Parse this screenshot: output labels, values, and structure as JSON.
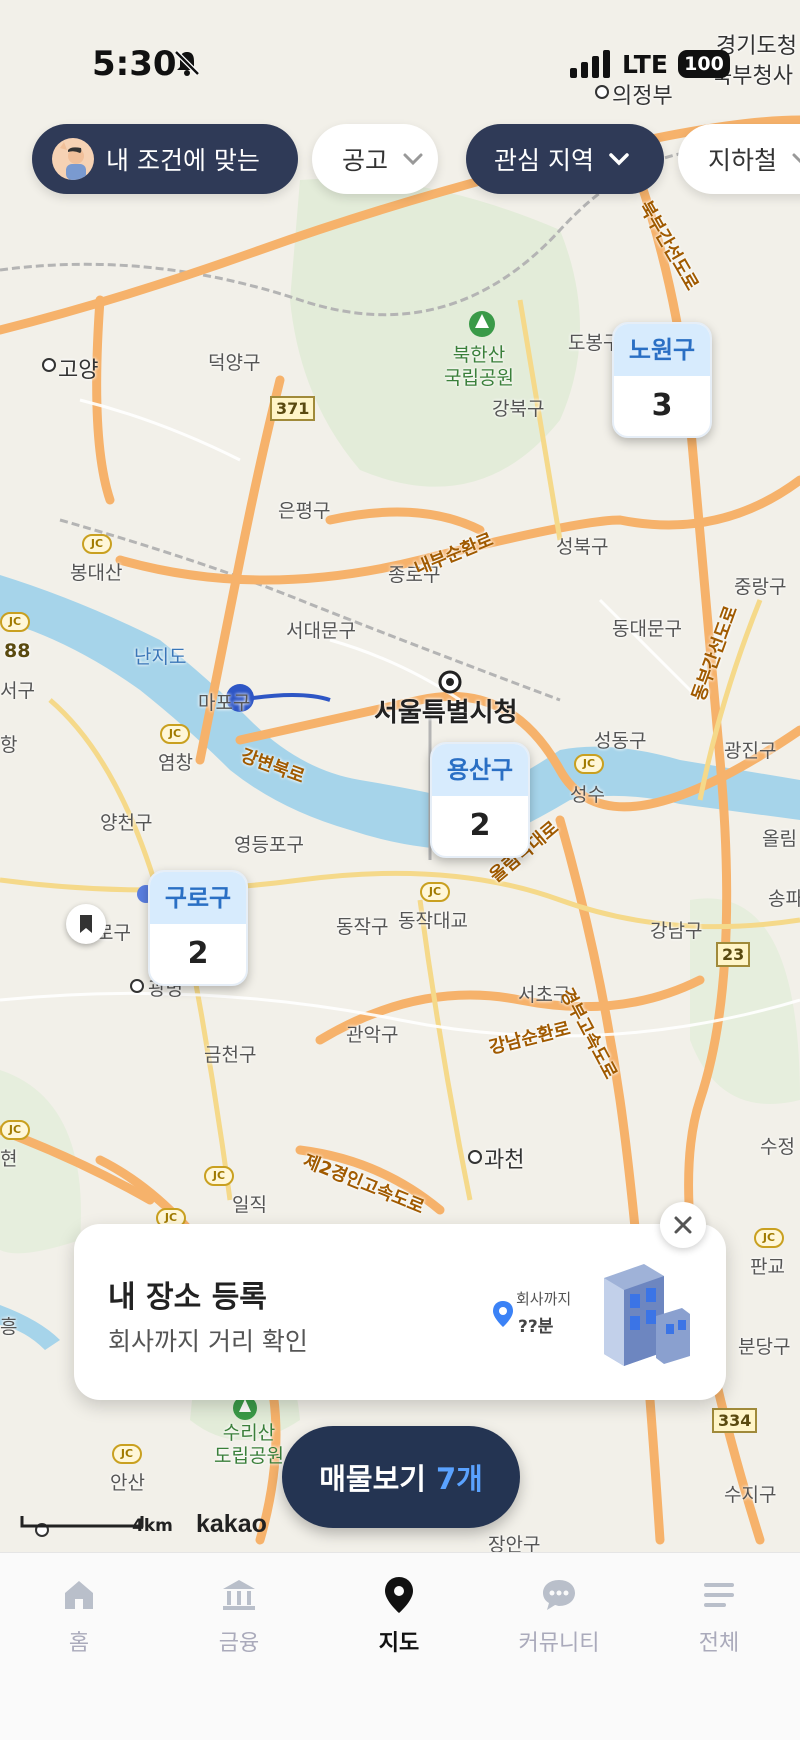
{
  "status_bar": {
    "time": "5:30",
    "network": "LTE",
    "battery": "100"
  },
  "filters": [
    {
      "label": "내 조건에 맞는",
      "style": "dark"
    },
    {
      "label": "공고",
      "style": "light"
    },
    {
      "label": "관심 지역",
      "style": "dark"
    },
    {
      "label": "지하철",
      "style": "light"
    }
  ],
  "map": {
    "labels": {
      "gyeonggi": "경기도청",
      "bukbu": "북부청사",
      "uijeongbu": "의정부",
      "goyang": "고양",
      "deogyang": "덕양구",
      "dobong": "도봉구",
      "bukhansan": "북한산\n국립공원",
      "gangbuk": "강북구",
      "eunpyeong": "은평구",
      "seongbuk": "성북구",
      "jongno": "종로구",
      "jungnang": "중랑구",
      "bongdaesan": "봉대산",
      "seodaemun": "서대문구",
      "dongdaemun": "동대문구",
      "nanjido": "난지도",
      "seogu": "서구",
      "mapo": "마포구",
      "cityhall": "서울특별시청",
      "seongdong": "성동구",
      "gwangjin": "광진구",
      "yeomchang": "염창",
      "yangcheon": "양천구",
      "yeongdeungpo": "영등포구",
      "seongsu": "성수",
      "olim": "올림",
      "songpa": "송파",
      "dongjak": "동작구",
      "dongjakbridge": "동작대교",
      "gangnam": "강남구",
      "seocho": "서초구",
      "gwanak": "관악구",
      "geumcheon": "금천구",
      "gwacheon": "과천",
      "gwangmyeong": "광명",
      "pangyo": "판교",
      "bundang": "분당구",
      "suji": "수지구",
      "ansan": "안산",
      "jangan": "장안구",
      "suri": "수리산\n도립공원",
      "iljik": "일직",
      "sujeong": "수정",
      "heung": "흥",
      "hyeon": "현",
      "hang": "항",
      "gu_left": "로구",
      "r371": "371",
      "r23": "23",
      "r334": "334",
      "r88": "88"
    },
    "roads": {
      "innerring": "내부순환로",
      "gangbyeon": "강변북로",
      "olympic": "올림픽대로",
      "gangnamsunhwan": "강남순환로",
      "gyeongbu": "경부고속도로",
      "jeil2": "제2경인고속도로",
      "bukbu_expr": "북부간선도로",
      "gangnam_express": "동부간선도로"
    },
    "scale": "4km",
    "provider": "kakao"
  },
  "markers": [
    {
      "name": "노원구",
      "count": "3"
    },
    {
      "name": "용산구",
      "count": "2"
    },
    {
      "name": "구로구",
      "count": "2"
    }
  ],
  "promo": {
    "title": "내 장소 등록",
    "subtitle": "회사까지 거리 확인",
    "illustration_label": "회사까지",
    "illustration_value": "??분"
  },
  "view_button": {
    "label": "매물보기",
    "count": "7개"
  },
  "tabs": [
    {
      "label": "홈",
      "icon": "home-icon"
    },
    {
      "label": "금융",
      "icon": "bank-icon"
    },
    {
      "label": "지도",
      "icon": "map-pin-icon"
    },
    {
      "label": "커뮤니티",
      "icon": "chat-icon"
    },
    {
      "label": "전체",
      "icon": "menu-icon"
    }
  ],
  "colors": {
    "brand_dark": "#243452",
    "accent_blue": "#5aa2ff",
    "marker_header": "#d7ebfd",
    "river": "#a6d4ea",
    "highway": "#f6b26b"
  }
}
